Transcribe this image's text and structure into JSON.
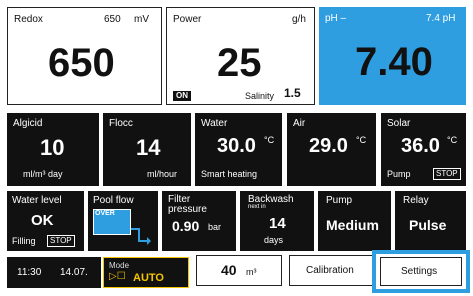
{
  "redox": {
    "label": "Redox",
    "value": "650",
    "unit": "mV",
    "display": "650"
  },
  "power": {
    "label": "Power",
    "unit": "g/h",
    "value": "25",
    "on_badge": "ON",
    "salinity_label": "Salinity",
    "salinity_value": "1.5"
  },
  "ph": {
    "label": "pH –",
    "value": "7.40",
    "right_label": "7.4 pH"
  },
  "algicid": {
    "label": "Algicid",
    "value": "10",
    "unit": "ml/m³ day"
  },
  "flocc": {
    "label": "Flocc",
    "value": "14",
    "unit": "ml/hour"
  },
  "water": {
    "label": "Water",
    "value": "30.0",
    "unit_sup": "°C",
    "sub": "Smart heating"
  },
  "air": {
    "label": "Air",
    "value": "29.0",
    "unit_sup": "°C"
  },
  "solar": {
    "label": "Solar",
    "value": "36.0",
    "unit_sup": "°C",
    "sub": "Pump",
    "stop": "STOP"
  },
  "water_level": {
    "label": "Water level",
    "value": "OK",
    "sub": "Filling",
    "stop": "STOP"
  },
  "pool_flow": {
    "label": "Pool flow",
    "badge": "OVER"
  },
  "filter": {
    "label_line1": "Filter",
    "label_line2": "pressure",
    "value": "0.90",
    "unit": "bar"
  },
  "backwash": {
    "label": "Backwash",
    "next": "next in",
    "value": "14",
    "unit": "days"
  },
  "pump": {
    "label": "Pump",
    "value": "Medium"
  },
  "relay": {
    "label": "Relay",
    "value": "Pulse"
  },
  "footer": {
    "time": "11:30",
    "date": "14.07.",
    "mode_label": "Mode",
    "mode_value": "AUTO",
    "volume_value": "40",
    "volume_unit": "m³",
    "calibration": "Calibration",
    "settings": "Settings"
  },
  "colors": {
    "accent_blue": "#2e9ee0",
    "mode_yellow": "#f5c400",
    "tile_dark": "#111111"
  }
}
